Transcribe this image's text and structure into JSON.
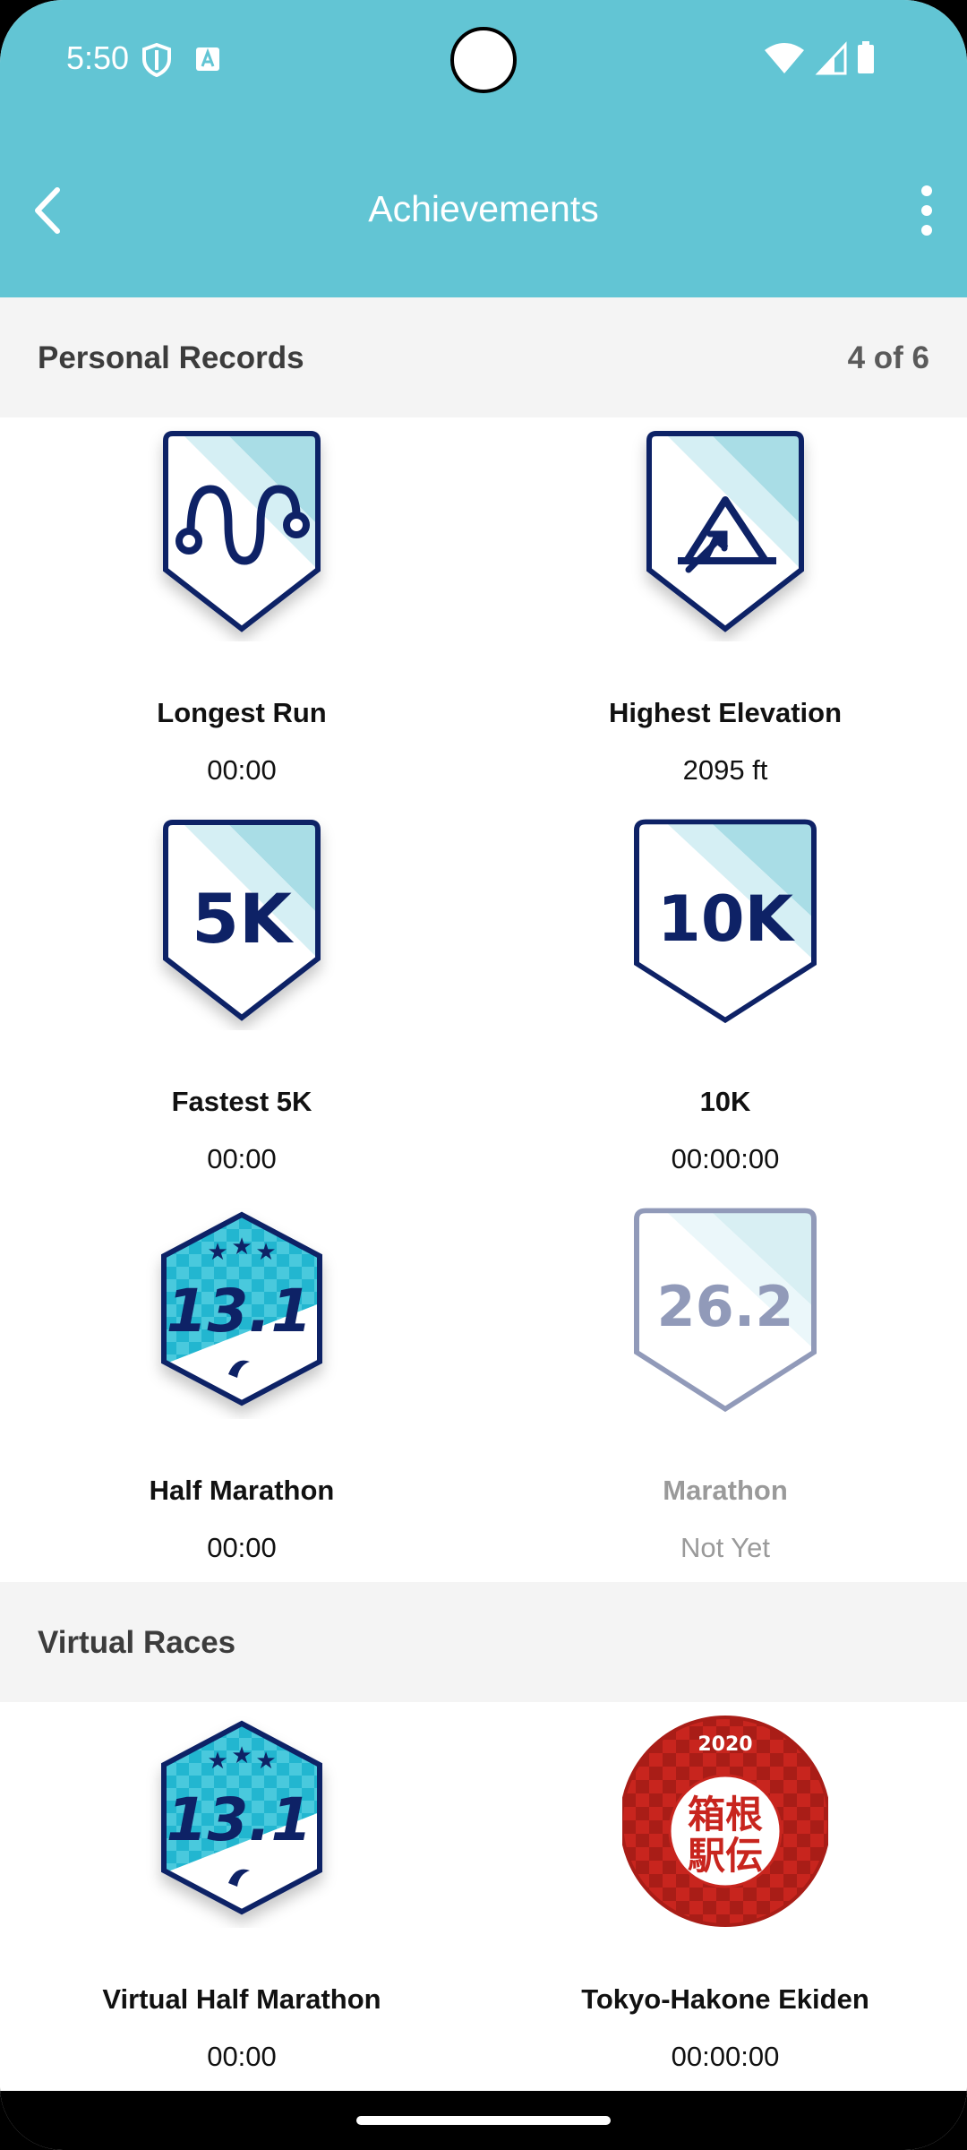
{
  "status_bar": {
    "time": "5:50"
  },
  "app_bar": {
    "title": "Achievements"
  },
  "personal_records": {
    "title": "Personal Records",
    "count": "4 of 6",
    "items": [
      {
        "name": "Longest Run",
        "value": "00:00",
        "icon": "winding-path-icon"
      },
      {
        "name": "Highest Elevation",
        "value": "2095 ft",
        "icon": "mountain-icon"
      },
      {
        "name": "Fastest 5K",
        "value": "00:00",
        "icon": "5k-badge-icon",
        "badge_text": "5K"
      },
      {
        "name": "10K",
        "value": "00:00:00",
        "icon": "10k-badge-icon",
        "badge_text": "10K"
      },
      {
        "name": "Half Marathon",
        "value": "00:00",
        "icon": "half-marathon-badge-icon",
        "badge_text": "13.1"
      },
      {
        "name": "Marathon",
        "value": "Not Yet",
        "icon": "marathon-badge-icon",
        "badge_text": "26.2",
        "achieved": false
      }
    ]
  },
  "virtual_races": {
    "title": "Virtual Races",
    "items": [
      {
        "name": "Virtual Half Marathon",
        "value": "00:00",
        "icon": "virtual-half-marathon-badge-icon",
        "badge_text": "13.1"
      },
      {
        "name": "Tokyo-Hakone Ekiden",
        "value": "00:00:00",
        "icon": "hakone-ekiden-badge-icon",
        "badge_text": "2020",
        "badge_text_2": "箱根",
        "badge_text_3": "駅伝"
      }
    ]
  },
  "colors": {
    "app_bar": "#62c5d4",
    "badge_navy": "#0e2266",
    "badge_light": "#a9dde6",
    "hakone_red": "#c8251e"
  }
}
